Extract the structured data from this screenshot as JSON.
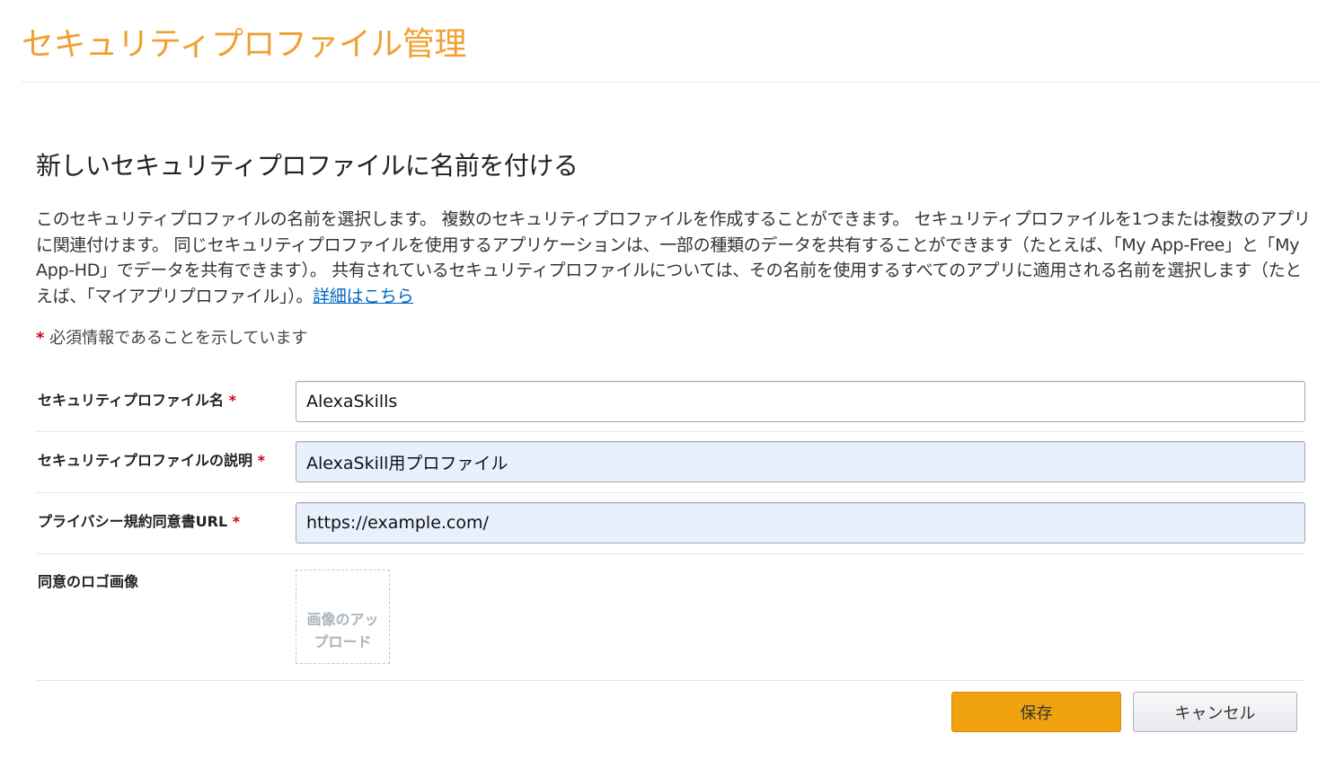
{
  "page": {
    "title": "セキュリティプロファイル管理",
    "accent_color": "#f0a030"
  },
  "section": {
    "heading": "新しいセキュリティプロファイルに名前を付ける",
    "description": "このセキュリティプロファイルの名前を選択します。 複数のセキュリティプロファイルを作成することができます。 セキュリティプロファイルを1つまたは複数のアプリに関連付けます。 同じセキュリティプロファイルを使用するアプリケーションは、一部の種類のデータを共有することができます（たとえば、「My App-Free」と「My App-HD」でデータを共有できます）。 共有されているセキュリティプロファイルについては、その名前を使用するすべてのアプリに適用される名前を選択します（たとえば、「マイアプリプロファイル」）。",
    "learn_more_link": "詳細はこちら",
    "link_color": "#0066c0"
  },
  "required_note": {
    "star": "*",
    "text": "必須情報であることを示しています",
    "star_color": "#d0021b"
  },
  "form": {
    "fields": [
      {
        "label": "セキュリティプロファイル名",
        "required_star": "*",
        "value": "AlexaSkills"
      },
      {
        "label": "セキュリティプロファイルの説明",
        "required_star": "*",
        "value": "AlexaSkill用プロファイル"
      },
      {
        "label": "プライバシー規約同意書URL",
        "required_star": "*",
        "value": "https://example.com/"
      }
    ],
    "logo": {
      "label": "同意のロゴ画像",
      "upload_text": "画像のアップロード"
    }
  },
  "buttons": {
    "save_label": "保存",
    "cancel_label": "キャンセル",
    "save_color": "#f0a30e"
  }
}
